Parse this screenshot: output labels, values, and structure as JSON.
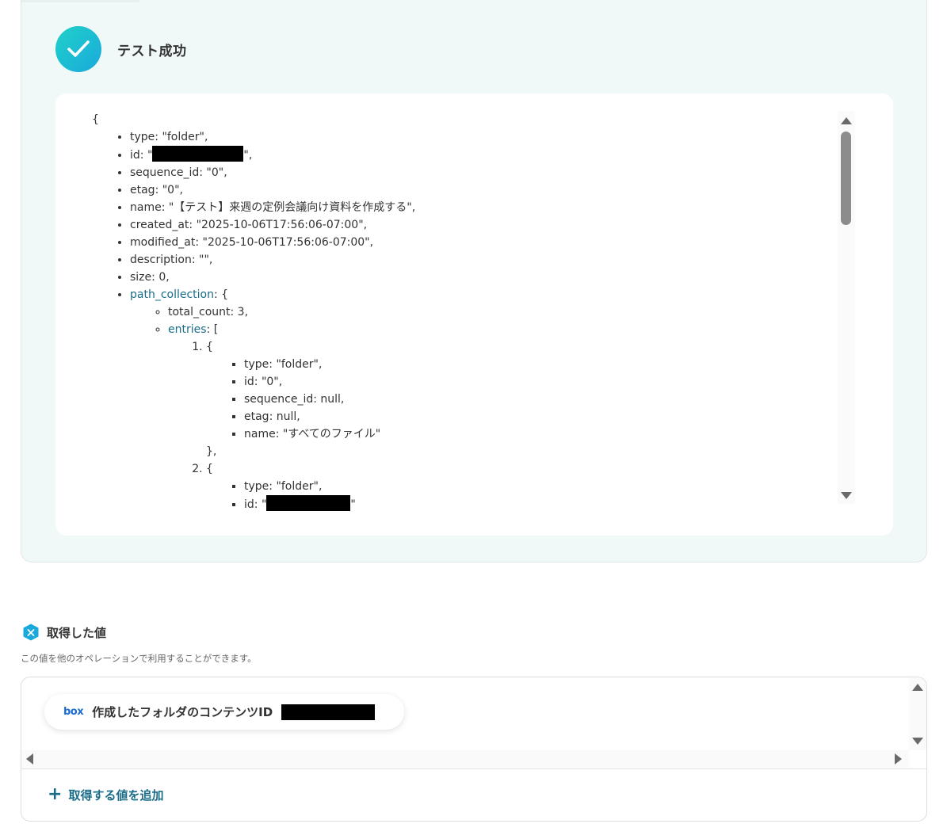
{
  "result": {
    "title": "テスト成功",
    "open_brace": "{",
    "fields": {
      "type": "type: \"folder\",",
      "id_prefix": "id: \"",
      "id_suffix": "\",",
      "sequence_id": "sequence_id: \"0\",",
      "etag": "etag: \"0\",",
      "name": "name: \"【テスト】来週の定例会議向け資料を作成する\",",
      "created_at": "created_at: \"2025-10-06T17:56:06-07:00\",",
      "modified_at": "modified_at: \"2025-10-06T17:56:06-07:00\",",
      "description": "description: \"\",",
      "size": "size: 0,",
      "path_collection_key": "path_collection",
      "path_collection_rest": ": {",
      "total_count": "total_count: 3,",
      "entries_key": "entries",
      "entries_rest": ": [",
      "brace_open": "{",
      "entry1": {
        "type": "type: \"folder\",",
        "id": "id: \"0\",",
        "sequence_id": "sequence_id: null,",
        "etag": "etag: null,",
        "name": "name: \"すべてのファイル\""
      },
      "entry_close": "},",
      "entry2": {
        "type": "type: \"folder\",",
        "id_prefix": "id: \"",
        "id_suffix": "\""
      }
    }
  },
  "values": {
    "title": "取得した値",
    "description": "この値を他のオペレーションで利用することができます。",
    "pill_logo": "box",
    "pill_label": "作成したフォルダのコンテンツID",
    "add_label": "取得する値を追加",
    "add_plus": "+"
  }
}
